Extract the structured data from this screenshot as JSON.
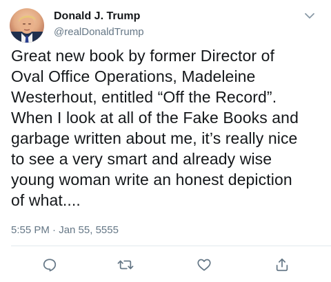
{
  "tweet": {
    "author": {
      "display_name": "Donald J. Trump",
      "handle": "@realDonaldTrump",
      "avatar_icon": "profile-photo"
    },
    "text": "Great new book by former Director of\nOval Office Operations, Madeleine\nWesterhout, entitled “Off the Record”.\nWhen I look at all of the Fake Books and\ngarbage written about me, it’s really nice\nto see a very smart and already wise\nyoung woman write an honest depiction\nof what....",
    "timestamp": "5:55 PM · Jan 55, 5555",
    "actions": [
      {
        "name": "reply",
        "icon": "reply-icon"
      },
      {
        "name": "retweet",
        "icon": "retweet-icon"
      },
      {
        "name": "like",
        "icon": "heart-icon"
      },
      {
        "name": "share",
        "icon": "share-icon"
      }
    ],
    "menu_icon": "chevron-down-icon"
  },
  "colors": {
    "text": "#14171a",
    "secondary": "#657786",
    "divider": "#e1e8ed",
    "icon": "#657786"
  }
}
